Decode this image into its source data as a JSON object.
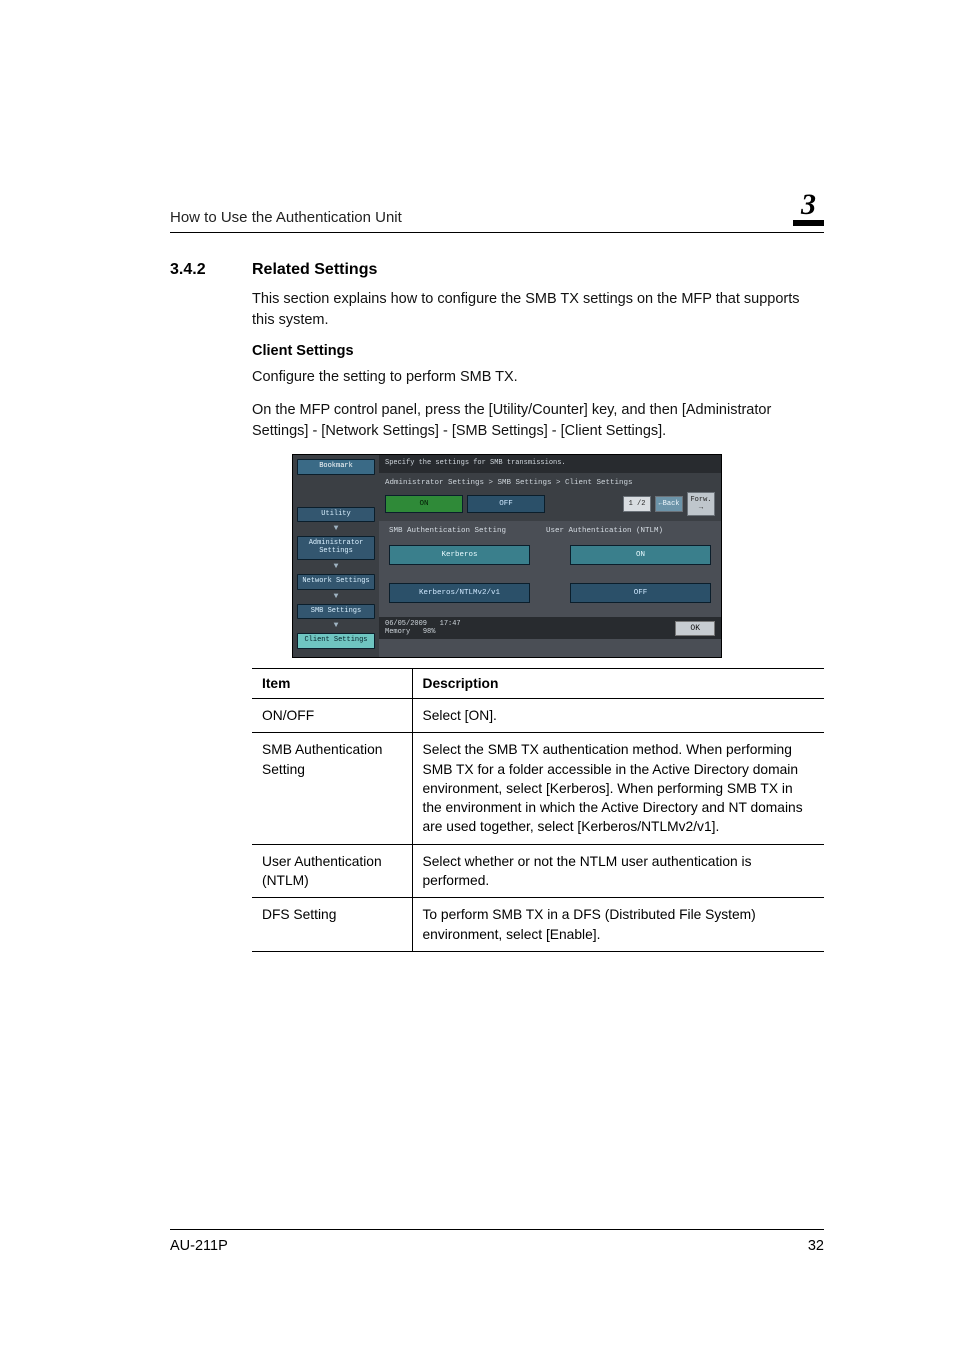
{
  "running_header": "How to Use the Authentication Unit",
  "chapter_number": "3",
  "section_number": "3.4.2",
  "section_title": "Related Settings",
  "intro_para": "This section explains how to configure the SMB TX settings on the MFP that supports this system.",
  "client_settings_heading": "Client Settings",
  "client_settings_p1": "Configure the setting to perform SMB TX.",
  "client_settings_p2": "On the MFP control panel, press the [Utility/Counter] key, and then [Administrator Settings] - [Network Settings] - [SMB Settings] - [Client Settings].",
  "panel": {
    "topstrip": "Specify the settings for SMB transmissions.",
    "sidebar": {
      "bookmark": "Bookmark",
      "utility": "Utility",
      "admin": "Administrator Settings",
      "network": "Network Settings",
      "smb": "SMB Settings",
      "client": "Client Settings"
    },
    "breadcrumb": "Administrator Settings > SMB Settings > Client Settings",
    "tab_on": "ON",
    "tab_off": "OFF",
    "page_counter": "1 /2",
    "back": "←Back",
    "fwd": "Forw. →",
    "label_left": "SMB Authentication Setting",
    "label_right": "User Authentication (NTLM)",
    "opt_kerberos": "Kerberos",
    "opt_on": "ON",
    "opt_kerb_ntlm": "Kerberos/NTLMv2/v1",
    "opt_off": "OFF",
    "status_date": "06/05/2009",
    "status_time": "17:47",
    "status_mem": "Memory",
    "status_mem_pct": "98%",
    "ok": "OK"
  },
  "table": {
    "head_item": "Item",
    "head_desc": "Description",
    "rows": [
      {
        "item": "ON/OFF",
        "desc": "Select [ON]."
      },
      {
        "item": "SMB Authentication Setting",
        "desc": "Select the SMB TX authentication method.\nWhen performing SMB TX for a folder accessible in the Active Directory domain environment, select [Kerberos]. When performing SMB TX in the environment in which the Active Directory and NT domains are used together, select [Kerberos/NTLMv2/v1]."
      },
      {
        "item": "User Authentication (NTLM)",
        "desc": "Select whether or not the NTLM user authentication is performed."
      },
      {
        "item": "DFS Setting",
        "desc": "To perform SMB TX in a DFS (Distributed File System) environment, select [Enable]."
      }
    ]
  },
  "footer_model": "AU-211P",
  "footer_page": "32"
}
